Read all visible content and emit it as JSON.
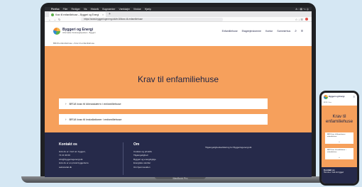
{
  "laptop": {
    "model_label": "MacBook Pro"
  },
  "menubar": {
    "apple": "",
    "items": [
      "Firefox",
      "Filer",
      "Rediger",
      "Vis",
      "Historik",
      "Bogmærker",
      "Værktøjer",
      "Vindue",
      "Hjælp"
    ],
    "right": "â ∷ ▤ ⌥ ◎"
  },
  "browser": {
    "tab_title": "Krav til enfamiliehuse – Byggeri og Energi",
    "tab_close": "×",
    "new_tab": "+",
    "back": "←",
    "forward": "→",
    "reload": "↻",
    "url": "https://www.byggeriogenergi.dk/br18/krav-til-enfamiliehuse",
    "actions": "☆ ↓ ☰"
  },
  "site": {
    "logo_title": "Byggeri og Energi",
    "logo_sub": "Information fra Energistyrelsen · Byggeri",
    "nav": [
      "Enfamiliehuse",
      "Etageejendomme",
      "Kontor",
      "Sommerhus"
    ],
    "search_icon": "⌕",
    "menu_icon": "≡",
    "breadcrumb": "BR18 enfamiliehuse  ›  Krav til enfamiliehuse",
    "hero_title": "Krav til enfamiliehuse",
    "accordions": [
      "BR18 krav til klimaskærm i enfamiliehuse",
      "BR18 krav til installationer i enfamiliehuse"
    ],
    "chevron": "›",
    "footer": {
      "contact": {
        "heading": "Kontakt os",
        "lines": [
          "Hvis du er i tvivl om byggeri,",
          "72 21 90 00",
          "info@byggeriogenergi.dk",
          "Hvis du er en privat byggeherre",
          "sekretariat.dk"
        ]
      },
      "about": {
        "heading": "Om",
        "lines": [
          "Cookies og privatliv",
          "Tilgængelighed",
          "Byggeri og energirigtige",
          "Energiske værdier",
          "Om hjemmesiden"
        ]
      },
      "link": "Tilgængelighedserklæring for Byggeriogenergi.dk"
    }
  },
  "phone": {
    "logo_text": "Byggeri og Energi",
    "menu_icon": "≡",
    "crumb": "BR18  ›  Krav",
    "title": "Krav til enfamiliehuse",
    "accordions": [
      "BR18 krav til klimaskærm i enfamiliehuse",
      "BR18 krav til installationer i enfamiliehuse"
    ],
    "plus": "+",
    "footer_heading": "Kontakt os",
    "footer_line": "Hvis du er i tvivl om byggeri"
  }
}
